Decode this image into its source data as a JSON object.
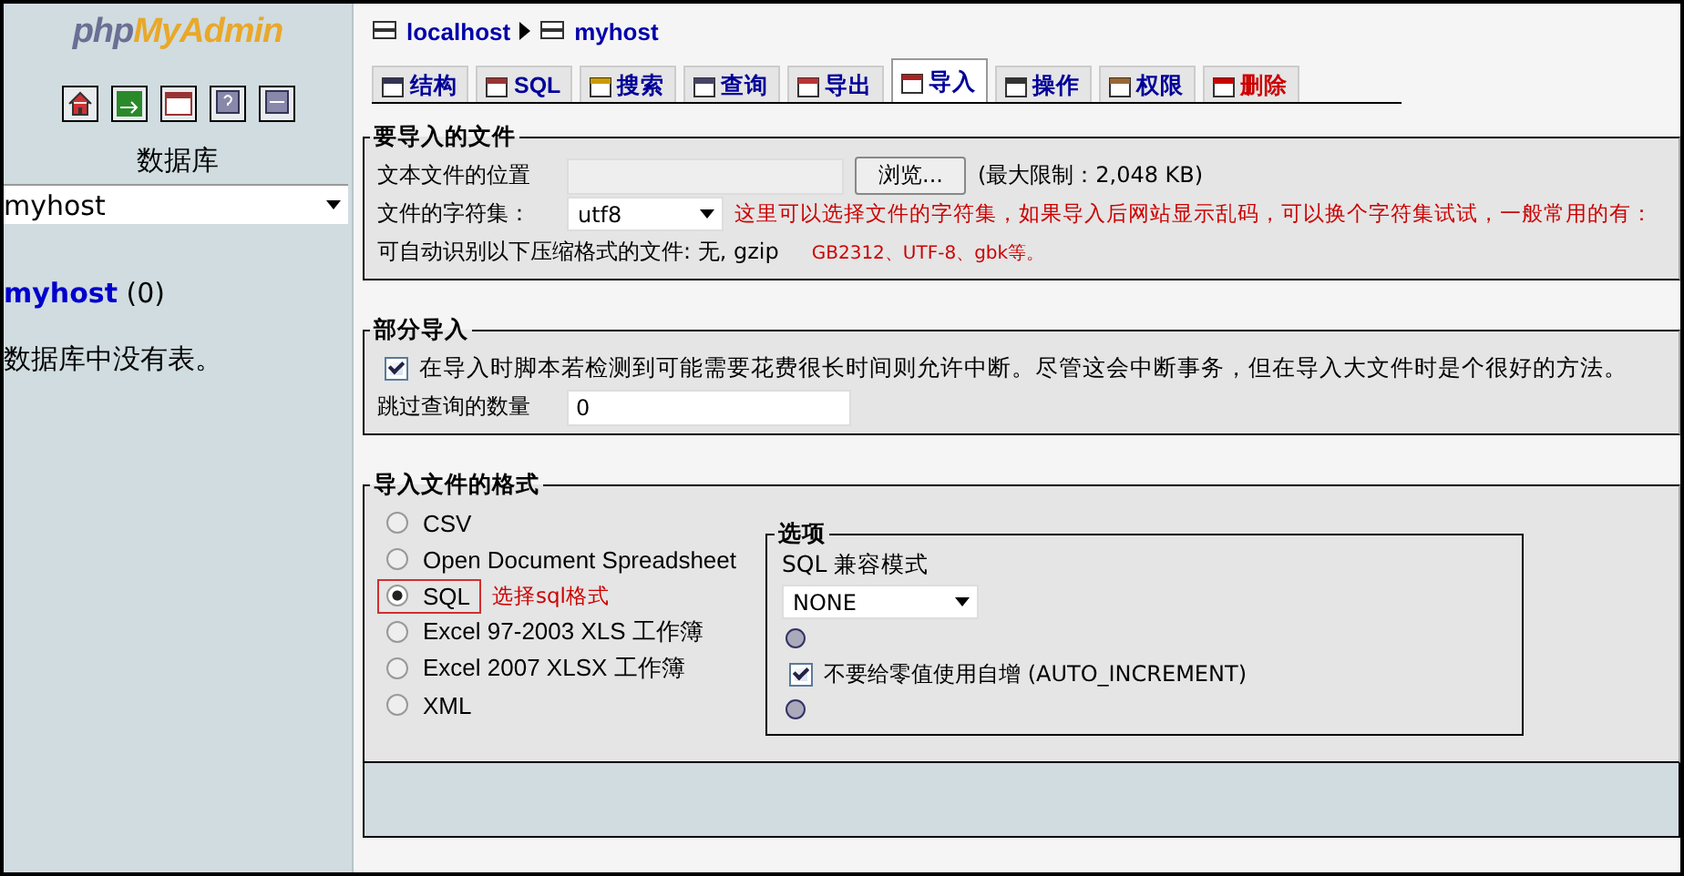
{
  "sidebar": {
    "logo_left": "php",
    "logo_right": "MyAdmin",
    "db_label": "数据库",
    "db_select": "myhost",
    "db_link": "myhost",
    "db_count": "(0)",
    "empty_note": "数据库中没有表。"
  },
  "breadcrumb": [
    "localhost",
    "myhost"
  ],
  "tabs": [
    {
      "label": "结构",
      "kind": "structure",
      "selected": false
    },
    {
      "label": "SQL",
      "kind": "sql",
      "selected": false
    },
    {
      "label": "搜索",
      "kind": "search",
      "selected": false
    },
    {
      "label": "查询",
      "kind": "query",
      "selected": false
    },
    {
      "label": "导出",
      "kind": "export",
      "selected": false
    },
    {
      "label": "导入",
      "kind": "import",
      "selected": true
    },
    {
      "label": "操作",
      "kind": "operations",
      "selected": false
    },
    {
      "label": "权限",
      "kind": "privileges",
      "selected": false
    },
    {
      "label": "删除",
      "kind": "drop",
      "selected": false
    }
  ],
  "file_section": {
    "legend": "要导入的文件",
    "location_label": "文本文件的位置",
    "browse": "浏览...",
    "limit": "(最大限制：2,048 KB)",
    "charset_label": "文件的字符集：",
    "charset": "utf8",
    "compress": "可自动识别以下压缩格式的文件: 无, gzip",
    "annotation_1": "这里可以选择文件的字符集，如果导入后网站显示乱码，可以换个字符集试试，一般常用的有：",
    "annotation_2": "GB2312、UTF-8、gbk等。"
  },
  "partial": {
    "legend": "部分导入",
    "interrupt": {
      "checked": true,
      "label": "在导入时脚本若检测到可能需要花费很长时间则允许中断。尽管这会中断事务，但在导入大文件时是个很好的方法。"
    },
    "skip_label": "跳过查询的数量",
    "skip_value": "0"
  },
  "format": {
    "legend": "导入文件的格式",
    "annotation": "选择sql格式",
    "options": [
      {
        "label": "CSV",
        "selected": false,
        "highlighted": false
      },
      {
        "label": "Open Document Spreadsheet",
        "selected": false,
        "highlighted": false
      },
      {
        "label": "SQL",
        "selected": true,
        "highlighted": true
      },
      {
        "label": "Excel 97-2003 XLS 工作簿",
        "selected": false,
        "highlighted": false
      },
      {
        "label": "Excel 2007 XLSX 工作簿",
        "selected": false,
        "highlighted": false
      },
      {
        "label": "XML",
        "selected": false,
        "highlighted": false
      }
    ],
    "options_box": {
      "legend": "选项",
      "compat_label": "SQL 兼容模式",
      "compat": "NONE",
      "no_auto": {
        "checked": true,
        "label": "不要给零值使用自增 (AUTO_INCREMENT)"
      }
    }
  }
}
